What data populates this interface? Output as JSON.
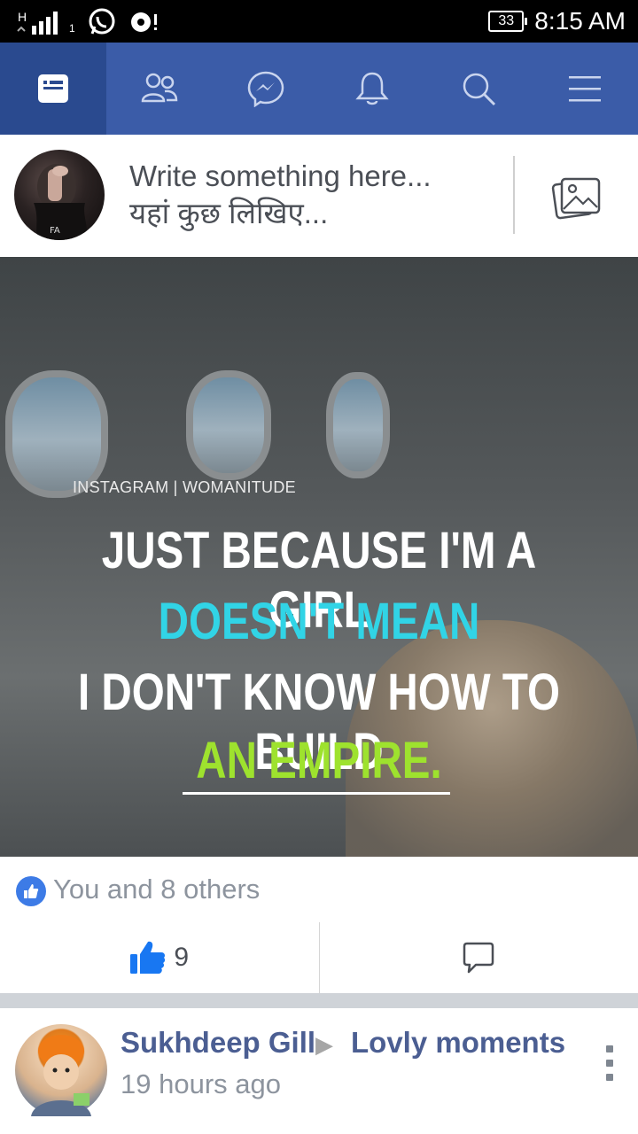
{
  "status_bar": {
    "network_type": "H",
    "sim_slot": "1",
    "battery_level": "33",
    "time": "8:15 AM",
    "icons": [
      "signal-icon",
      "whatsapp-icon",
      "media-notification-icon"
    ]
  },
  "nav": {
    "tabs": [
      {
        "name": "news-feed",
        "icon": "news-feed-icon",
        "active": true
      },
      {
        "name": "friends",
        "icon": "friends-icon",
        "active": false
      },
      {
        "name": "messenger",
        "icon": "messenger-icon",
        "active": false
      },
      {
        "name": "notifications",
        "icon": "bell-icon",
        "active": false
      },
      {
        "name": "search",
        "icon": "search-icon",
        "active": false
      },
      {
        "name": "menu",
        "icon": "hamburger-menu-icon",
        "active": false
      }
    ],
    "colors": {
      "bar": "#3b5ca8",
      "active": "#2a4a8f"
    }
  },
  "composer": {
    "placeholder_en": "Write something here...",
    "placeholder_hi": "यहां कुछ लिखिए...",
    "photo_icon": "photo-icon"
  },
  "post": {
    "image": {
      "caption": "INSTAGRAM | WOMANITUDE",
      "line1": "JUST BECAUSE I'M A GIRL",
      "line2": "DOESN'T MEAN",
      "line3": "I DON'T KNOW HOW TO BUILD",
      "line4": "AN EMPIRE.",
      "colors": {
        "line2": "#31d4e6",
        "line4": "#9ee22e"
      }
    },
    "reactions_text": "You and 8 others",
    "like_count": "9"
  },
  "next_post": {
    "author": "Sukhdeep Gill",
    "group": "Lovly moments",
    "time": "19 hours ago"
  }
}
